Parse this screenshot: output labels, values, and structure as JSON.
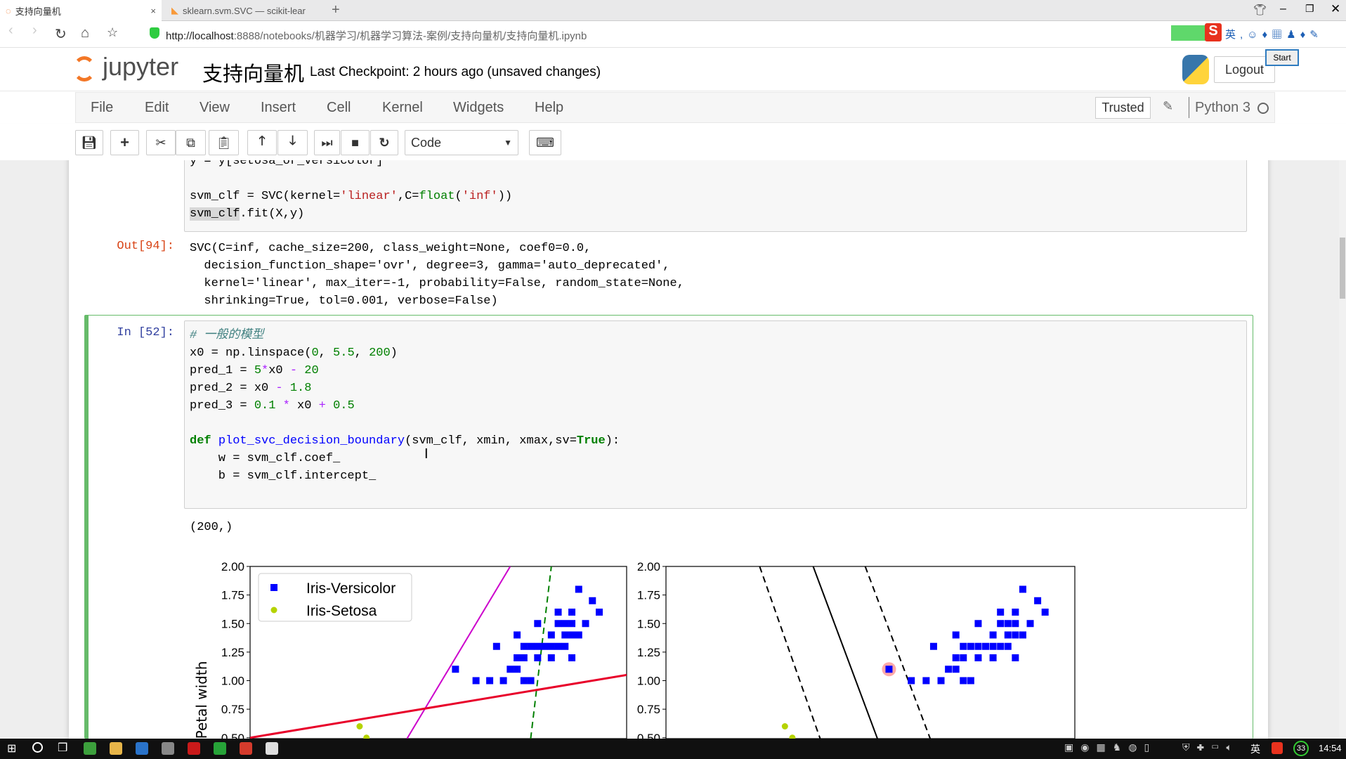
{
  "browser": {
    "tabs": [
      {
        "label": "支持向量机",
        "active": true
      },
      {
        "label": "sklearn.svm.SVC — scikit-lear"
      }
    ],
    "new_tab": "+",
    "url_host": "http://localhost",
    "url_rest": ":8888/notebooks/机器学习/机器学习算法-案例/支持向量机/支持向量机.ipynb",
    "ime_tooltip": "Start",
    "window_controls": [
      "minimize",
      "restore",
      "close"
    ]
  },
  "header": {
    "logo_text": "jupyter",
    "notebook_title": "支持向量机",
    "checkpoint": "Last Checkpoint: 2 hours ago (unsaved changes)",
    "logout": "Logout"
  },
  "menu": {
    "items": [
      "File",
      "Edit",
      "View",
      "Insert",
      "Cell",
      "Kernel",
      "Widgets",
      "Help"
    ],
    "trusted": "Trusted",
    "kernel": "Python 3"
  },
  "toolbar": {
    "cell_type": "Code",
    "buttons": [
      "save",
      "insert-below",
      "cut",
      "copy",
      "paste",
      "move-up",
      "move-down",
      "run",
      "interrupt",
      "restart",
      "command-palette"
    ]
  },
  "cells": [
    {
      "prompt": "",
      "lines": [
        [
          [
            "y = y[setosa_or_versicolor]",
            ""
          ]
        ],
        [],
        [
          [
            "svm_clf = SVC(kernel=",
            ""
          ],
          [
            "'linear'",
            "str"
          ],
          [
            ",C=",
            ""
          ],
          [
            "float",
            "bi"
          ],
          [
            "(",
            ""
          ],
          [
            "'inf'",
            "str"
          ],
          [
            "))",
            ""
          ]
        ],
        [
          [
            "svm_clf",
            ""
          ],
          [
            ".fit(X,y)",
            ""
          ]
        ]
      ],
      "out_prompt": "Out[94]:",
      "output": [
        "SVC(C=inf, cache_size=200, class_weight=None, coef0=0.0,",
        "  decision_function_shape='ovr', degree=3, gamma='auto_deprecated',",
        "  kernel='linear', max_iter=-1, probability=False, random_state=None,",
        "  shrinking=True, tol=0.001, verbose=False)"
      ]
    },
    {
      "prompt": "In [52]:",
      "lines": [
        [
          [
            "# 一般的模型",
            "cm"
          ]
        ],
        [
          [
            "x0 = np.linspace(",
            ""
          ],
          [
            "0",
            "num"
          ],
          [
            ", ",
            ""
          ],
          [
            "5.5",
            "num"
          ],
          [
            ", ",
            ""
          ],
          [
            "200",
            "num"
          ],
          [
            ")",
            ""
          ]
        ],
        [
          [
            "pred_1 = ",
            ""
          ],
          [
            "5",
            "num"
          ],
          [
            "*",
            "op"
          ],
          [
            "x0 ",
            ""
          ],
          [
            "-",
            "op"
          ],
          [
            " ",
            ""
          ],
          [
            "20",
            "num"
          ]
        ],
        [
          [
            "pred_2 = x0 ",
            ""
          ],
          [
            "-",
            "op"
          ],
          [
            " ",
            ""
          ],
          [
            "1.8",
            "num"
          ]
        ],
        [
          [
            "pred_3 = ",
            ""
          ],
          [
            "0.1",
            "num"
          ],
          [
            " ",
            ""
          ],
          [
            "*",
            "op"
          ],
          [
            " x0 ",
            ""
          ],
          [
            "+",
            "op"
          ],
          [
            " ",
            ""
          ],
          [
            "0.5",
            "num"
          ]
        ],
        [],
        [
          [
            "def",
            "kw"
          ],
          [
            " ",
            ""
          ],
          [
            "plot_svc_decision_boundary",
            "fn"
          ],
          [
            "(svm_clf, xmin, xmax,sv=",
            ""
          ],
          [
            "True",
            "kw"
          ],
          [
            "):",
            ""
          ]
        ],
        [
          [
            "    w = svm_clf.coef_",
            ""
          ]
        ],
        [
          [
            "    b = svm_clf.intercept_",
            ""
          ]
        ]
      ],
      "output": [
        "(200,)"
      ]
    }
  ],
  "chart_data": [
    {
      "type": "scatter",
      "ylabel": "Petal width",
      "xlim": [
        0,
        5.5
      ],
      "ylim": [
        0,
        2
      ],
      "yticks": [
        "0.50",
        "0.75",
        "1.00",
        "1.25",
        "1.50",
        "1.75",
        "2.00"
      ],
      "legend": {
        "placement": "top-left",
        "entries": [
          "Iris-Versicolor",
          "Iris-Setosa"
        ]
      },
      "series": [
        {
          "name": "Iris-Versicolor",
          "marker": "square",
          "color": "#0000ff",
          "points": [
            [
              4.7,
              1.4
            ],
            [
              4.5,
              1.5
            ],
            [
              4.9,
              1.5
            ],
            [
              4.0,
              1.3
            ],
            [
              4.6,
              1.5
            ],
            [
              4.5,
              1.3
            ],
            [
              4.7,
              1.6
            ],
            [
              3.3,
              1.0
            ],
            [
              4.6,
              1.3
            ],
            [
              3.9,
              1.4
            ],
            [
              3.5,
              1.0
            ],
            [
              4.2,
              1.5
            ],
            [
              4.0,
              1.0
            ],
            [
              3.6,
              1.3
            ],
            [
              4.4,
              1.4
            ],
            [
              4.1,
              1.0
            ],
            [
              3.9,
              1.1
            ],
            [
              4.8,
              1.8
            ],
            [
              4.7,
              1.2
            ],
            [
              4.3,
              1.3
            ],
            [
              4.8,
              1.4
            ],
            [
              5.0,
              1.7
            ],
            [
              3.8,
              1.1
            ],
            [
              3.7,
              1.0
            ],
            [
              3.9,
              1.2
            ],
            [
              5.1,
              1.6
            ],
            [
              4.5,
              1.6
            ],
            [
              4.7,
              1.5
            ],
            [
              4.4,
              1.3
            ],
            [
              4.1,
              1.3
            ],
            [
              4.4,
              1.2
            ],
            [
              4.6,
              1.4
            ],
            [
              4.0,
              1.2
            ],
            [
              4.2,
              1.3
            ],
            [
              4.2,
              1.2
            ],
            [
              3.0,
              1.1
            ]
          ]
        },
        {
          "name": "Iris-Setosa",
          "marker": "circle",
          "color": "#b5d300",
          "points": [
            [
              1.6,
              0.6
            ],
            [
              1.7,
              0.5
            ]
          ]
        }
      ],
      "lines": [
        {
          "expr": "5*x0-20",
          "slope": 5,
          "intercept": -20,
          "color": "#008000",
          "style": "dashed"
        },
        {
          "expr": "x0-1.8",
          "slope": 1,
          "intercept": -1.8,
          "color": "#cc00cc",
          "style": "solid"
        },
        {
          "expr": "0.1*x0+0.5",
          "slope": 0.1,
          "intercept": 0.5,
          "color": "#e8002a",
          "style": "solid"
        }
      ]
    },
    {
      "type": "scatter",
      "xlim": [
        0,
        5.5
      ],
      "ylim": [
        0,
        2
      ],
      "yticks": [
        "0.50",
        "0.75",
        "1.00",
        "1.25",
        "1.50",
        "1.75",
        "2.00"
      ],
      "series": [
        {
          "marker": "square",
          "color": "#0000ff",
          "points": "same-as-left"
        },
        {
          "marker": "circle",
          "color": "#b5d300",
          "points": "same-as-left"
        }
      ],
      "support_vectors": [
        [
          3.0,
          1.1
        ]
      ],
      "lines": [
        {
          "role": "decision-boundary",
          "p1": [
            1.98,
            2.0
          ],
          "p2": [
            2.84,
            0.5
          ],
          "color": "#000000",
          "style": "solid"
        },
        {
          "role": "margin",
          "p1": [
            1.26,
            2.0
          ],
          "p2": [
            2.07,
            0.5
          ],
          "color": "#000000",
          "style": "dashed"
        },
        {
          "role": "margin",
          "p1": [
            2.68,
            2.0
          ],
          "p2": [
            3.55,
            0.5
          ],
          "color": "#000000",
          "style": "dashed"
        }
      ]
    }
  ],
  "taskbar": {
    "clock": "14:54",
    "ime": "英",
    "badge": "33"
  }
}
